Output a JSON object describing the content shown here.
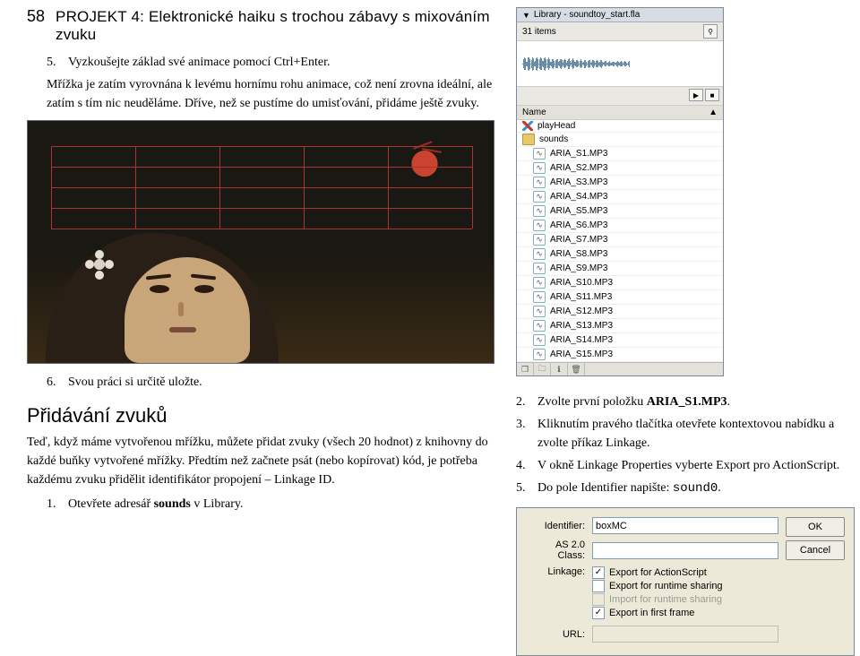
{
  "header": {
    "page_number": "58",
    "project_title": "PROJEKT 4: Elektronické haiku s trochou zábavy s mixováním zvuku"
  },
  "left": {
    "step5_num": "5.",
    "step5": "Vyzkoušejte základ své animace pomocí Ctrl+Enter.",
    "para1": "Mřížka je zatím vyrovnána k levému hornímu rohu animace, což není zrovna ideální, ale zatím s tím nic neuděláme. Dříve, než se pustíme do umisťování, přidáme ještě zvuky.",
    "step6_num": "6.",
    "step6": "Svou práci si určitě uložte.",
    "section_title": "Přidávání zvuků",
    "para2": "Teď, když máme vytvořenou mřížku, můžete přidat zvuky (všech 20 hodnot) z knihovny do každé buňky vytvořené mřížky. Předtím než začnete psát (nebo kopírovat) kód, je potřeba každému zvuku přidělit identifikátor propojení – Linkage ID.",
    "step1_num": "1.",
    "step1_a": "Otevřete adresář ",
    "step1_b": "sounds",
    "step1_c": " v Library."
  },
  "right": {
    "s2_num": "2.",
    "s2_a": "Zvolte první položku ",
    "s2_b": "ARIA_S1.MP3",
    "s2_c": ".",
    "s3_num": "3.",
    "s3": "Kliknutím pravého tlačítka otevřete kontextovou nabídku a zvolte příkaz Linkage.",
    "s4_num": "4.",
    "s4": "V okně Linkage Properties vyberte Export pro ActionScript.",
    "s5_num": "5.",
    "s5_a": "Do pole Identifier napište: ",
    "s5_b": "sound0",
    "s5_c": "."
  },
  "library": {
    "title": "Library - soundtoy_start.fla",
    "count": "31 items",
    "name_col": "Name",
    "folder_playhead": "playHead",
    "folder_sounds": "sounds",
    "rows": [
      "ARIA_S1.MP3",
      "ARIA_S2.MP3",
      "ARIA_S3.MP3",
      "ARIA_S4.MP3",
      "ARIA_S5.MP3",
      "ARIA_S6.MP3",
      "ARIA_S7.MP3",
      "ARIA_S8.MP3",
      "ARIA_S9.MP3",
      "ARIA_S10.MP3",
      "ARIA_S11.MP3",
      "ARIA_S12.MP3",
      "ARIA_S13.MP3",
      "ARIA_S14.MP3",
      "ARIA_S15.MP3"
    ]
  },
  "linkage": {
    "lbl_identifier": "Identifier:",
    "identifier_value": "boxMC",
    "lbl_as2": "AS 2.0 Class:",
    "as2_value": "",
    "lbl_linkage": "Linkage:",
    "chk1": "Export for ActionScript",
    "chk2": "Export for runtime sharing",
    "chk3": "Import for runtime sharing",
    "chk4": "Export in first frame",
    "lbl_url": "URL:",
    "btn_ok": "OK",
    "btn_cancel": "Cancel"
  }
}
